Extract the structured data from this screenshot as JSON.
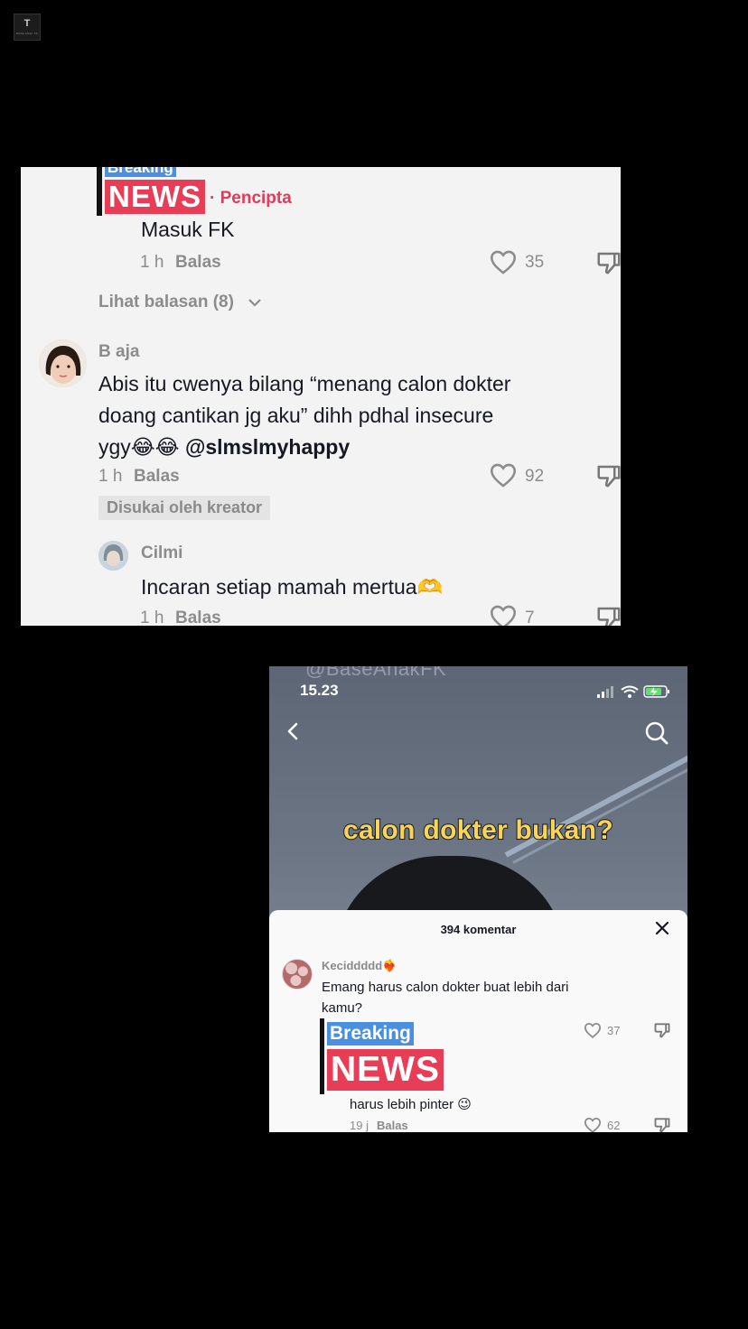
{
  "watermark_logo": {
    "letter": "T",
    "text": "BASE ANAK FK"
  },
  "shot1": {
    "badge": {
      "top": "Breaking",
      "bottom": "NEWS"
    },
    "creator_tag": "· Pencipta",
    "reply1": {
      "text": "Masuk FK",
      "time": "1 h",
      "reply_label": "Balas",
      "likes": "35"
    },
    "view_replies": "Lihat balasan (8)",
    "comment": {
      "username": "B aja",
      "line1": "Abis itu cwenya bilang “menang calon dokter",
      "line2": "doang cantikan jg aku” dihh pdhal insecure",
      "line3_text": "ygy😂😂",
      "mention": "@slmslmyhappy",
      "time": "1 h",
      "reply_label": "Balas",
      "likes": "92",
      "liked_by_creator": "Disukai oleh kreator"
    },
    "reply2": {
      "username": "Cilmi",
      "text": "Incaran setiap mamah mertua🫶",
      "time": "1 h",
      "reply_label": "Balas",
      "likes": "7"
    }
  },
  "shot2": {
    "watermark": "@BaseAnakFK",
    "status_time": "15.23",
    "caption": "calon dokter bukan?",
    "sheet_title": "394 komentar",
    "comment": {
      "username": "Keciddddd❤️‍🔥",
      "line1": "Emang harus calon dokter buat lebih dari",
      "line2": "kamu?",
      "likes": "37"
    },
    "badge": {
      "top": "Breaking",
      "bottom": "NEWS"
    },
    "reply": {
      "text": "harus lebih pinter 😉",
      "time": "19 j",
      "reply_label": "Balas",
      "likes": "62"
    }
  },
  "colors": {
    "badge_blue": "#4a8fe0",
    "badge_red": "#e83d56",
    "creator_red": "#e8375a",
    "caption_yellow": "#f7d55a"
  }
}
